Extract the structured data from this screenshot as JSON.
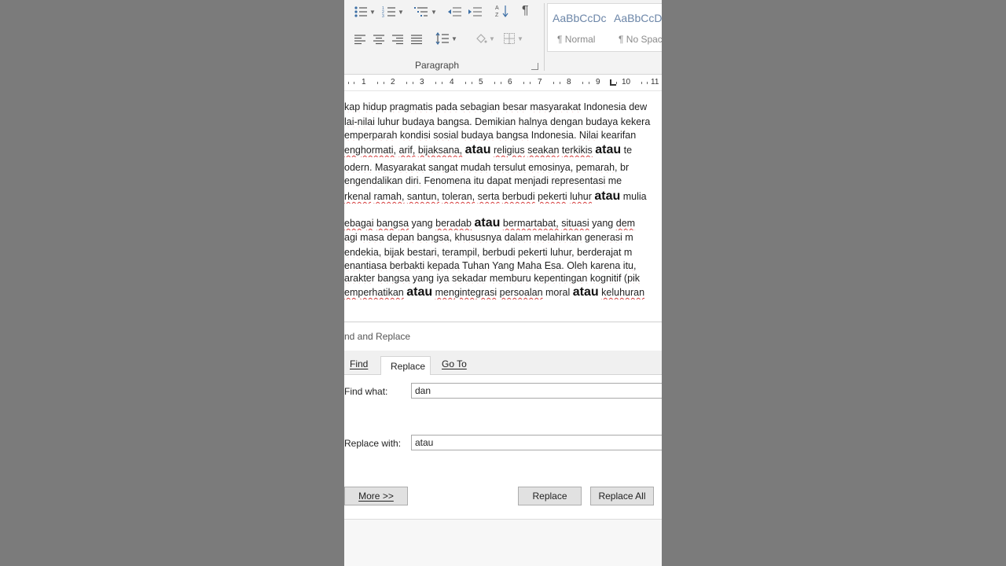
{
  "ribbon": {
    "group_label": "Paragraph",
    "styles": [
      {
        "preview": "AaBbCcDc",
        "name": "¶ Normal"
      },
      {
        "preview": "AaBbCcDc",
        "name": "¶ No Spac..."
      }
    ]
  },
  "ruler": {
    "numbers": [
      "1",
      "2",
      "3",
      "4",
      "5",
      "6",
      "7",
      "8",
      "9",
      "10",
      "11"
    ]
  },
  "document": {
    "lines": [
      "kap hidup pragmatis pada sebagian besar masyarakat Indonesia dew",
      "lai-nilai luhur budaya bangsa. Demikian halnya dengan budaya kekera",
      "emperparah kondisi sosial budaya bangsa Indonesia. Nilai kearifan",
      "enghormati, arif, bijaksana, atau religius seakan terkikis atau te",
      "odern. Masyarakat sangat mudah tersulut emosinya, pemarah, br",
      "engendalikan diri. Fenomena itu dapat menjadi representasi me",
      "rkenal ramah, santun, toleran, serta berbudi pekerti luhur atau mulia",
      "ebagai bangsa yang beradab atau bermartabat, situasi yang dem",
      "agi masa depan bangsa, khususnya dalam melahirkan generasi m",
      "endekia, bijak bestari, terampil, berbudi pekerti luhur, berderajat m",
      "enantiasa berbakti kepada Tuhan Yang Maha Esa. Oleh karena itu,",
      "arakter bangsa yang iya sekadar memburu kepentingan kognitif (pik",
      "emperhatikan atau mengintegrasi persoalan moral atau keluhuran"
    ]
  },
  "dialog": {
    "title": "nd and Replace",
    "tabs": [
      "Find",
      "Replace",
      "Go To"
    ],
    "find_label": "Find what:",
    "find_value": "dan",
    "replace_label": "Replace with:",
    "replace_value": "atau",
    "more_button": "More >>",
    "replace_button": "Replace",
    "replace_all_button": "Replace All"
  }
}
